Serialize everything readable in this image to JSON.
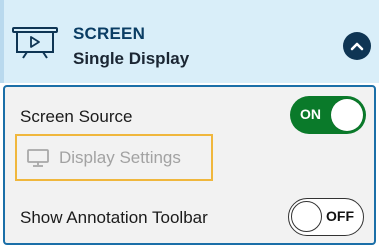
{
  "header": {
    "title": "SCREEN",
    "subtitle": "Single Display",
    "icon": "projector-screen-icon",
    "collapse_icon": "chevron-up-icon",
    "bg_color": "#d9eef9",
    "title_color": "#0a3d64"
  },
  "panel": {
    "border_color": "#1b6fa8",
    "screen_source": {
      "label": "Screen Source",
      "toggle_state": "ON",
      "toggle_color": "#0a7a2a"
    },
    "display_settings": {
      "label": "Display Settings",
      "icon": "monitor-icon",
      "enabled": false,
      "highlight_color": "#f0b73d"
    },
    "annotation_toolbar": {
      "label": "Show Annotation Toolbar",
      "toggle_state": "OFF"
    }
  }
}
